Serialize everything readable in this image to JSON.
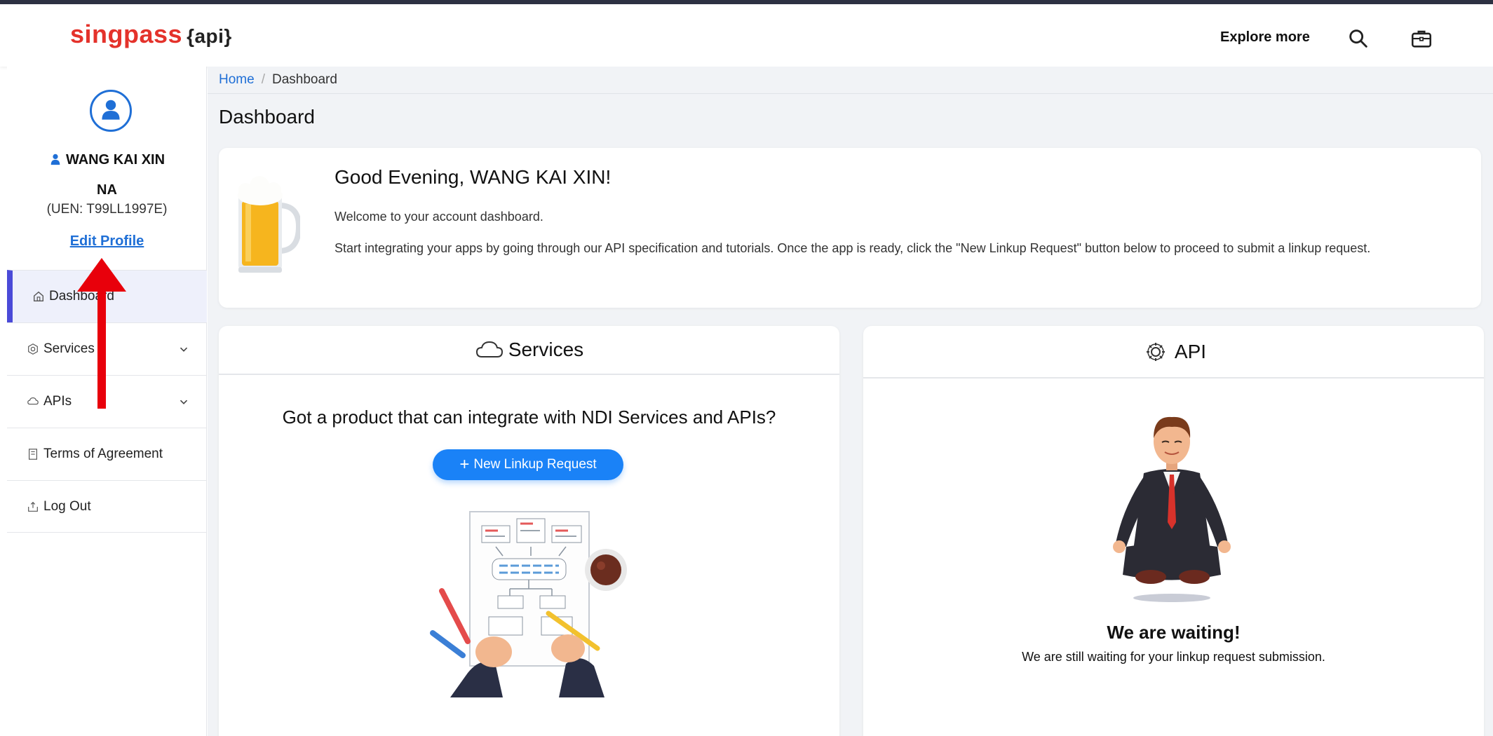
{
  "header": {
    "logo_brand": "singpass",
    "logo_api": "{api}",
    "explore_label": "Explore more"
  },
  "profile": {
    "name": "WANG KAI XIN",
    "org": "NA",
    "uen": "(UEN: T99LL1997E)",
    "edit_label": "Edit Profile"
  },
  "sidebar": {
    "items": [
      {
        "label": "Dashboard",
        "icon": "home-icon",
        "active": true
      },
      {
        "label": "Services",
        "icon": "services-icon",
        "expandable": true
      },
      {
        "label": "APIs",
        "icon": "cloud-icon",
        "expandable": true
      },
      {
        "label": "Terms of Agreement",
        "icon": "document-icon"
      },
      {
        "label": "Log Out",
        "icon": "logout-icon"
      }
    ]
  },
  "breadcrumb": {
    "home": "Home",
    "separator": "/",
    "current": "Dashboard"
  },
  "page": {
    "title": "Dashboard"
  },
  "welcome": {
    "greeting": "Good Evening, WANG KAI XIN!",
    "line1": "Welcome to your account dashboard.",
    "line2": "Start integrating your apps by going through our API specification and tutorials. Once the app is ready, click the \"New Linkup Request\" button below to proceed to submit a linkup request."
  },
  "services_card": {
    "title": "Services",
    "question": "Got a product that can integrate with NDI Services and APIs?",
    "button_label": "New Linkup Request"
  },
  "api_card": {
    "title": "API",
    "waiting_title": "We are waiting!",
    "waiting_sub": "We are still waiting for your linkup request submission."
  },
  "colors": {
    "brand_red": "#e4322b",
    "primary_blue": "#1f6fd6",
    "button_blue": "#1a82f7",
    "active_accent": "#4a4ad8",
    "annotation_red": "#e8000b"
  }
}
